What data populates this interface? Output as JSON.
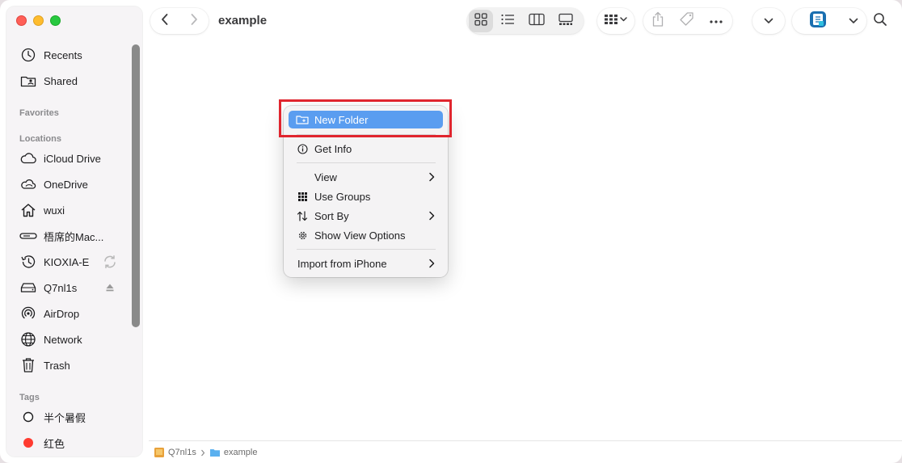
{
  "window": {
    "title": "example"
  },
  "sidebar": {
    "items_top": [
      {
        "label": "Recents",
        "icon": "clock-icon"
      },
      {
        "label": "Shared",
        "icon": "shared-folder-icon"
      }
    ],
    "favorites_title": "Favorites",
    "locations_title": "Locations",
    "locations": [
      {
        "label": "iCloud Drive",
        "icon": "cloud-icon"
      },
      {
        "label": "OneDrive",
        "icon": "cloud-outline-icon"
      },
      {
        "label": "wuxi",
        "icon": "home-icon"
      },
      {
        "label": "梧席的Mac...",
        "icon": "computer-icon"
      },
      {
        "label": "KIOXIA-E",
        "icon": "time-machine-icon"
      },
      {
        "label": "Q7nl1s",
        "icon": "drive-icon"
      },
      {
        "label": "AirDrop",
        "icon": "airdrop-icon"
      },
      {
        "label": "Network",
        "icon": "globe-icon"
      },
      {
        "label": "Trash",
        "icon": "trash-icon"
      }
    ],
    "tags_title": "Tags",
    "tags": [
      {
        "label": "半个暑假",
        "color": "#ffffff"
      },
      {
        "label": "红色",
        "color": "#ff3b30"
      }
    ]
  },
  "toolbar": {
    "back": "chevron-left-icon",
    "forward": "chevron-right-icon",
    "views": [
      "icon-view-icon",
      "list-view-icon",
      "column-view-icon",
      "gallery-view-icon"
    ],
    "group": "group-icon",
    "share": "share-icon",
    "tag": "tag-icon",
    "more": "ellipsis-icon",
    "search": "search-icon"
  },
  "menu": {
    "items": [
      {
        "label": "New Folder",
        "icon": "new-folder-icon",
        "highlighted": true
      },
      {
        "label": "Get Info",
        "icon": "info-icon"
      },
      {
        "label": "View",
        "submenu": true
      },
      {
        "label": "Use Groups",
        "icon": "grid-icon"
      },
      {
        "label": "Sort By",
        "icon": "sort-icon",
        "submenu": true
      },
      {
        "label": "Show View Options",
        "icon": "gear-icon"
      },
      {
        "label": "Import from iPhone",
        "submenu": true
      }
    ]
  },
  "pathbar": {
    "segments": [
      "Q7nl1s",
      "example"
    ]
  },
  "colors": {
    "accent": "#5a9df0",
    "annotation": "#e0252e"
  }
}
